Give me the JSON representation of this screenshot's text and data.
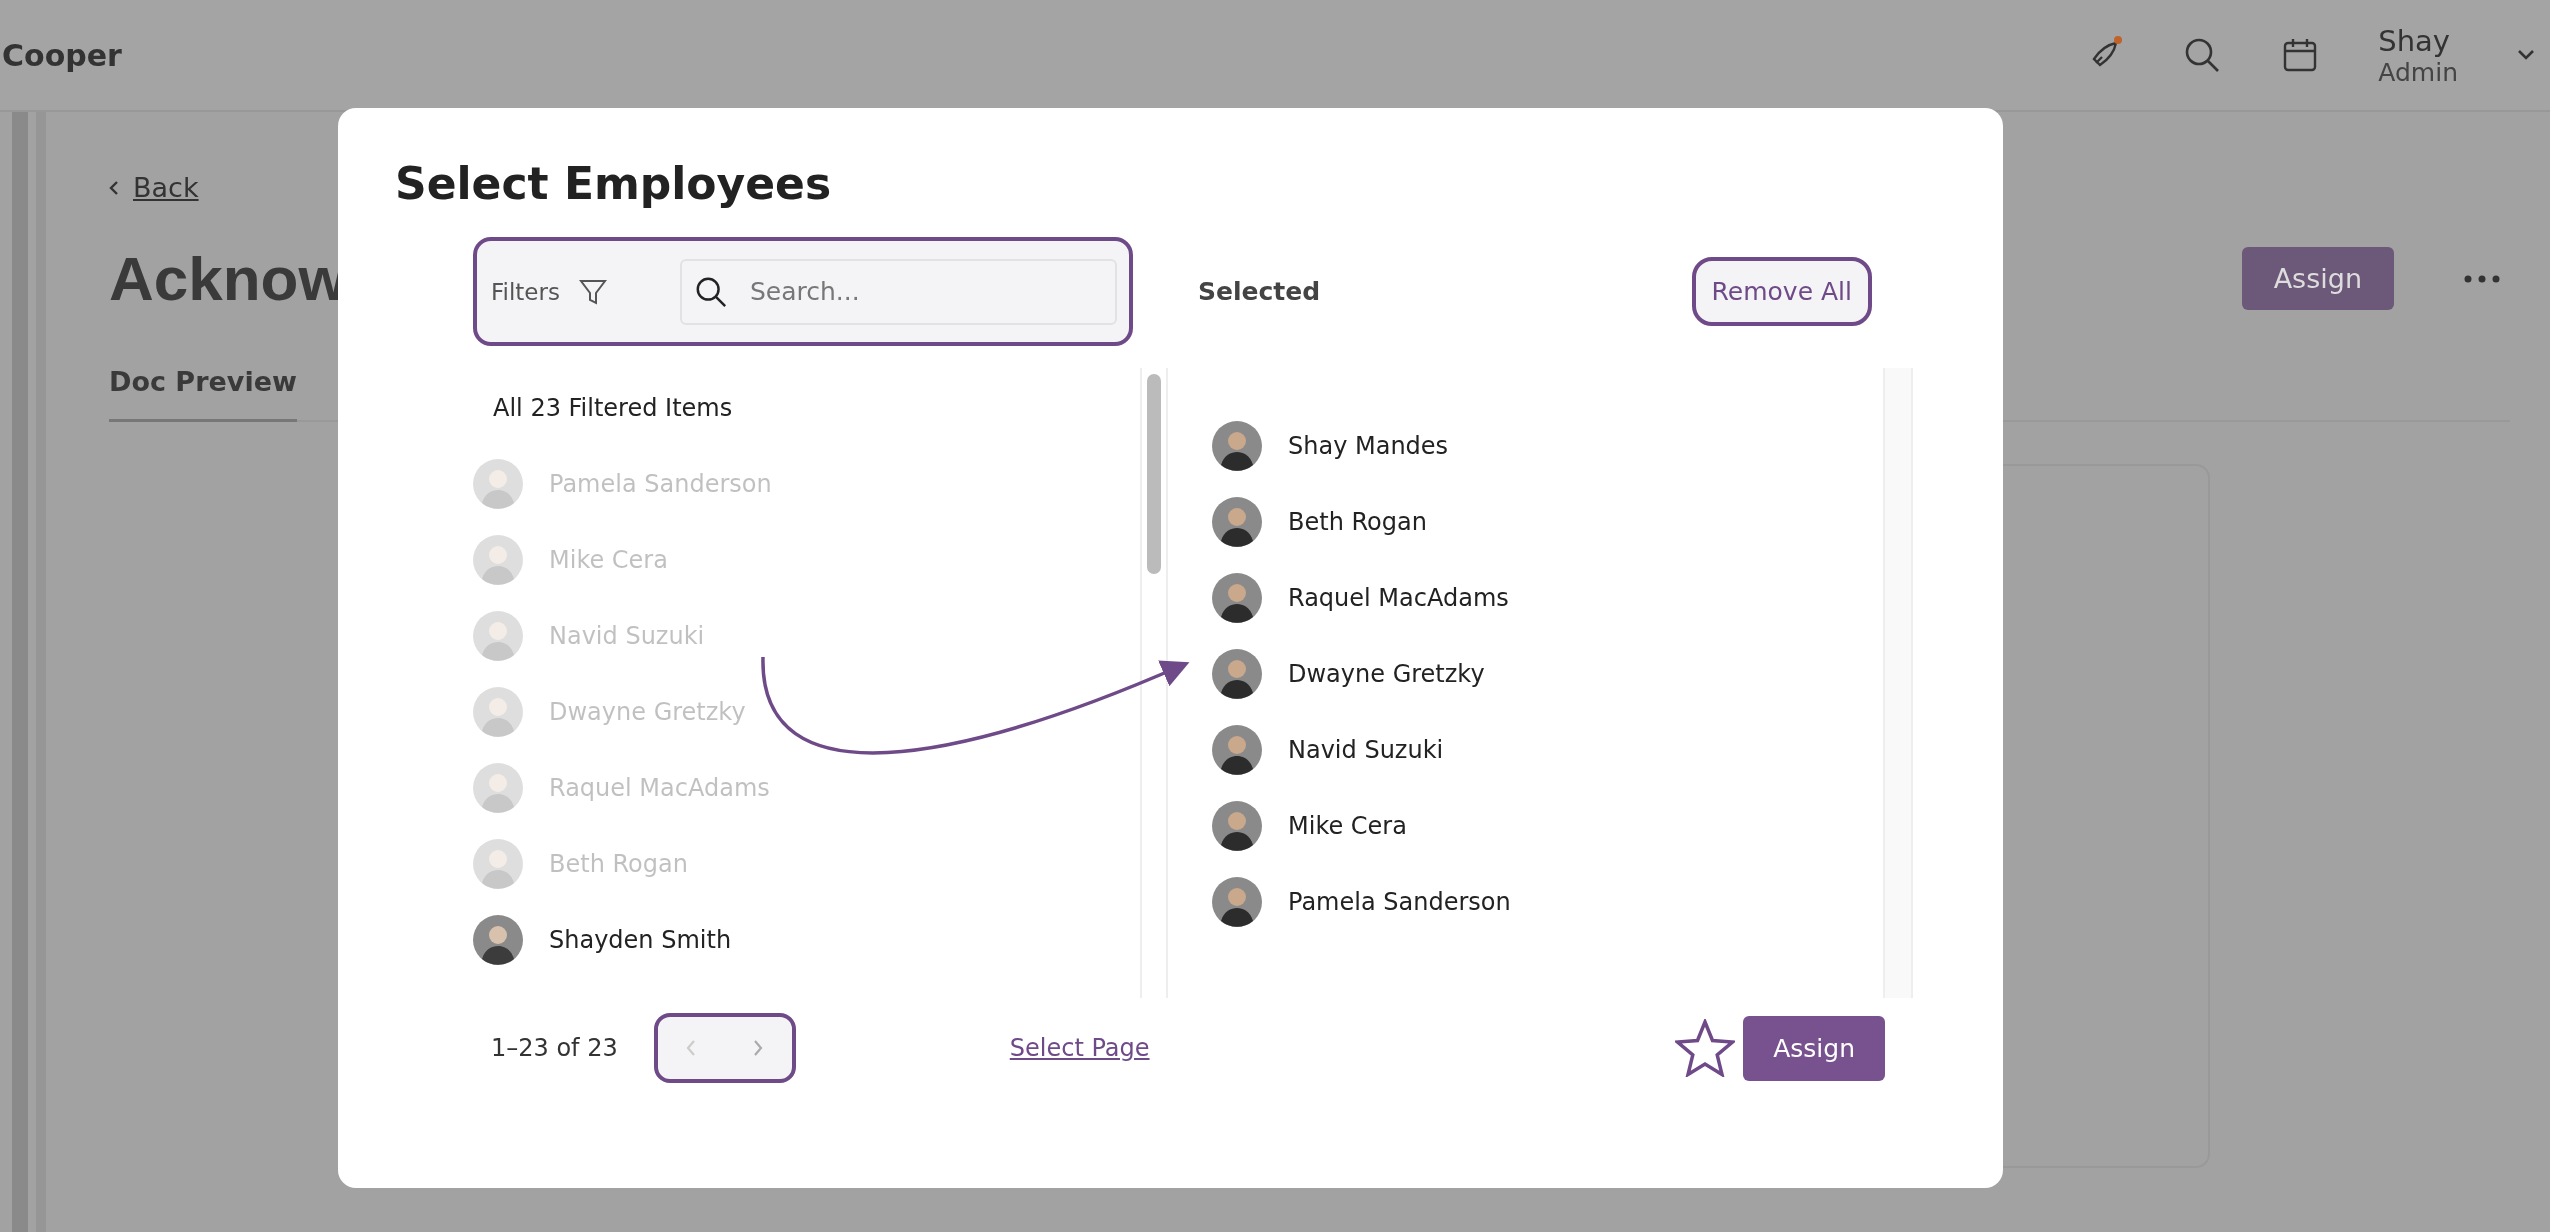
{
  "app_header": {
    "brand": "Cooper",
    "user_name": "Shay",
    "user_role": "Admin"
  },
  "page": {
    "back_link": "Back",
    "title": "Acknow",
    "assign_button": "Assign",
    "tabs": [
      {
        "label": "Doc Preview",
        "selected": true
      }
    ]
  },
  "modal": {
    "title": "Select Employees",
    "filters_label": "Filters",
    "search": {
      "placeholder": "Search..."
    },
    "selected_heading": "Selected",
    "remove_all_button": "Remove All",
    "available": {
      "heading": "All 23 Filtered Items",
      "items": [
        {
          "name": "Pamela Sanderson",
          "added": true
        },
        {
          "name": "Mike Cera",
          "added": true
        },
        {
          "name": "Navid Suzuki",
          "added": true
        },
        {
          "name": "Dwayne Gretzky",
          "added": true
        },
        {
          "name": "Raquel MacAdams",
          "added": true
        },
        {
          "name": "Beth Rogan",
          "added": true
        },
        {
          "name": "Shayden Smith",
          "added": false
        }
      ]
    },
    "selected_items": [
      {
        "name": "Shay Mandes"
      },
      {
        "name": "Beth Rogan"
      },
      {
        "name": "Raquel MacAdams"
      },
      {
        "name": "Dwayne Gretzky"
      },
      {
        "name": "Navid Suzuki"
      },
      {
        "name": "Mike Cera"
      },
      {
        "name": "Pamela Sanderson"
      }
    ],
    "pagination": {
      "range": "1–23 of 23"
    },
    "select_page_link": "Select Page",
    "assign_button": "Assign"
  }
}
